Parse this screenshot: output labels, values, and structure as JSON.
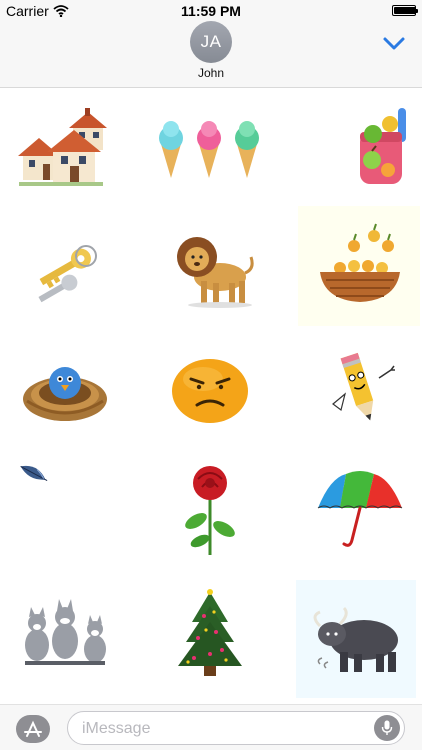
{
  "status_bar": {
    "carrier": "Carrier",
    "time": "11:59 PM",
    "battery_level": 1.0,
    "wifi_icon": "wifi-icon",
    "battery_icon": "battery-icon"
  },
  "header": {
    "avatar_initials": "JA",
    "contact_name": "John",
    "collapse_icon": "chevron-down-icon",
    "accent_color": "#2a7ae2"
  },
  "stickers": [
    {
      "id": "houses",
      "icon": "houses-sticker"
    },
    {
      "id": "ice-creams",
      "icon": "ice-cream-cones-sticker"
    },
    {
      "id": "fruit-jar",
      "icon": "fruit-jar-sticker"
    },
    {
      "id": "key",
      "icon": "key-sticker"
    },
    {
      "id": "lion",
      "icon": "lion-sticker"
    },
    {
      "id": "fruit-basket",
      "icon": "fruit-basket-sticker"
    },
    {
      "id": "bird-nest",
      "icon": "bird-in-nest-sticker"
    },
    {
      "id": "grumpy-orange",
      "icon": "grumpy-orange-face-sticker"
    },
    {
      "id": "pencil",
      "icon": "pencil-character-sticker"
    },
    {
      "id": "feather",
      "icon": "feather-sticker"
    },
    {
      "id": "rose",
      "icon": "red-rose-sticker"
    },
    {
      "id": "umbrella",
      "icon": "umbrella-sticker"
    },
    {
      "id": "wolves",
      "icon": "wolves-sticker"
    },
    {
      "id": "christmas-tree",
      "icon": "christmas-tree-sticker"
    },
    {
      "id": "yak",
      "icon": "yak-sticker"
    }
  ],
  "input_bar": {
    "placeholder": "iMessage",
    "value": "",
    "apps_icon": "app-store-icon",
    "mic_icon": "microphone-icon"
  }
}
